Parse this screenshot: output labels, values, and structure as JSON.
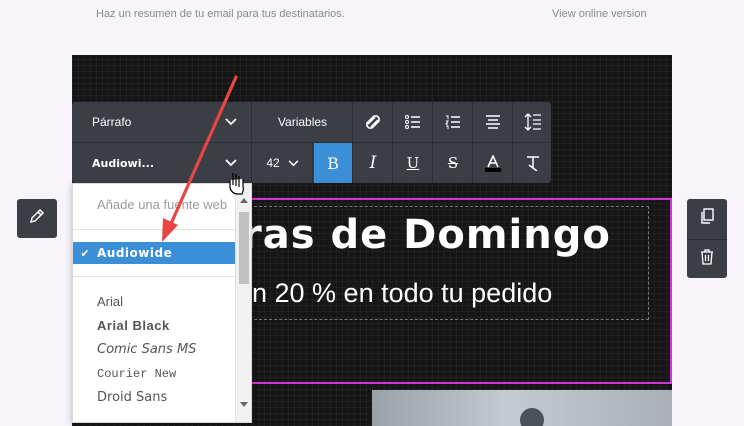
{
  "email": {
    "preheader": "Haz un resumen de tu email para tus destinatarios.",
    "view_online": "View online version",
    "headline": "ras de Domingo",
    "subline": "n 20 % en todo tu pedido"
  },
  "toolbar": {
    "block_format": "Párrafo",
    "variables": "Variables",
    "font_name": "Audiowi...",
    "font_size": "42",
    "icons": [
      "link-icon",
      "bullet-list-icon",
      "numbered-list-icon",
      "align-icon",
      "line-height-icon",
      "bold-icon",
      "italic-icon",
      "underline-icon",
      "strikethrough-icon",
      "text-color-icon",
      "clear-format-icon"
    ]
  },
  "font_dropdown": {
    "placeholder": "Añade una fuente web",
    "selected": "Audiowide",
    "items": [
      "Arial",
      "Arial Black",
      "Comic Sans MS",
      "Courier New",
      "Droid Sans"
    ]
  },
  "colors": {
    "toolbar_bg": "#3b3e44",
    "accent_blue": "#3a8fd6",
    "selection_border": "#d633d6",
    "annotation_arrow": "#e84545"
  }
}
